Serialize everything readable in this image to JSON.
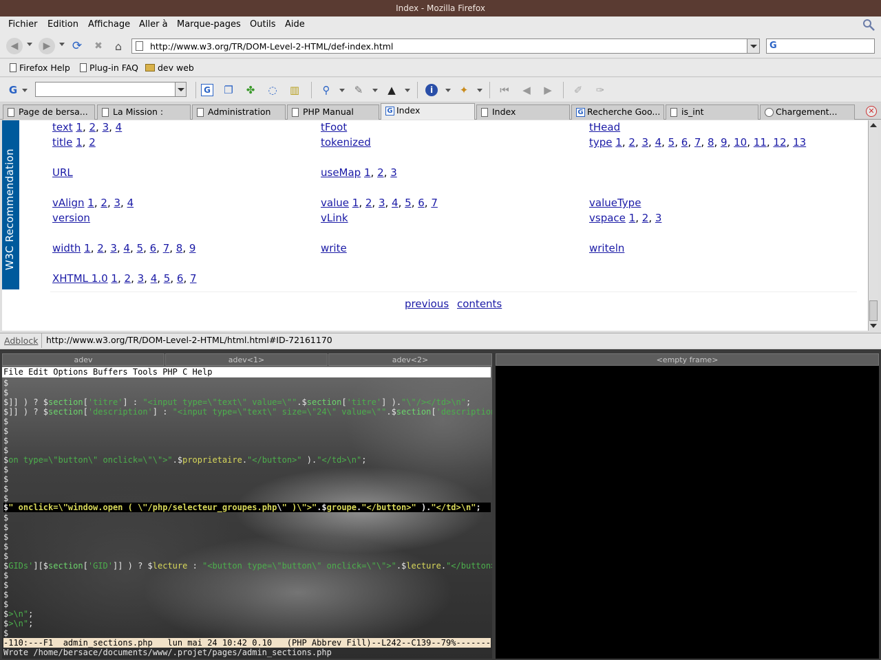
{
  "window": {
    "title": "Index - Mozilla Firefox"
  },
  "menu": [
    "Fichier",
    "Edition",
    "Affichage",
    "Aller à",
    "Marque-pages",
    "Outils",
    "Aide"
  ],
  "navigation": {
    "url": "http://www.w3.org/TR/DOM-Level-2-HTML/def-index.html",
    "search_value": ""
  },
  "bookmarks": [
    {
      "label": "Firefox Help",
      "icon": "page-icon"
    },
    {
      "label": "Plug-in FAQ",
      "icon": "page-icon"
    },
    {
      "label": "dev web",
      "icon": "folder-icon"
    }
  ],
  "tabs": [
    {
      "label": "Page de bersa...",
      "icon": "page-icon"
    },
    {
      "label": "La Mission :",
      "icon": "page-icon"
    },
    {
      "label": "Administration",
      "icon": "page-icon"
    },
    {
      "label": "PHP Manual",
      "icon": "page-icon"
    },
    {
      "label": "Index",
      "icon": "google-icon",
      "active": true
    },
    {
      "label": "Index",
      "icon": "page-icon"
    },
    {
      "label": "Recherche Goo...",
      "icon": "google-icon"
    },
    {
      "label": "is_int",
      "icon": "page-icon"
    },
    {
      "label": "Chargement...",
      "icon": "loading-icon"
    }
  ],
  "page": {
    "sidebar_label": "W3C Recommendation",
    "rows": [
      [
        {
          "term": "text",
          "refs": [
            "1",
            "2",
            "3",
            "4"
          ]
        },
        {
          "term": "tFoot",
          "refs": []
        },
        {
          "term": "tHead",
          "refs": []
        }
      ],
      [
        {
          "term": "title",
          "refs": [
            "1",
            "2"
          ]
        },
        {
          "term": "tokenized",
          "refs": []
        },
        {
          "term": "type",
          "refs": [
            "1",
            "2",
            "3",
            "4",
            "5",
            "6",
            "7",
            "8",
            "9",
            "10",
            "11",
            "12",
            "13"
          ]
        }
      ],
      [
        {
          "term": "URL",
          "refs": []
        },
        {
          "term": "useMap",
          "refs": [
            "1",
            "2",
            "3"
          ]
        },
        null
      ],
      [
        {
          "term": "vAlign",
          "refs": [
            "1",
            "2",
            "3",
            "4"
          ]
        },
        {
          "term": "value",
          "refs": [
            "1",
            "2",
            "3",
            "4",
            "5",
            "6",
            "7"
          ]
        },
        {
          "term": "valueType",
          "refs": []
        }
      ],
      [
        {
          "term": "version",
          "refs": []
        },
        {
          "term": "vLink",
          "refs": []
        },
        {
          "term": "vspace",
          "refs": [
            "1",
            "2",
            "3"
          ]
        }
      ],
      [
        {
          "term": "width",
          "refs": [
            "1",
            "2",
            "3",
            "4",
            "5",
            "6",
            "7",
            "8",
            "9"
          ]
        },
        {
          "term": "write",
          "refs": []
        },
        {
          "term": "writeln",
          "refs": []
        }
      ],
      [
        {
          "term": "XHTML 1.0",
          "refs": [
            "1",
            "2",
            "3",
            "4",
            "5",
            "6",
            "7"
          ]
        },
        null,
        null
      ]
    ],
    "footer_links": {
      "previous": "previous",
      "contents": "contents"
    }
  },
  "status": {
    "adblock": "Adblock",
    "url": "http://www.w3.org/TR/DOM-Level-2-HTML/html.html#ID-72161170"
  },
  "terminal": {
    "tabs": [
      "adev",
      "adev<1>",
      "adev<2>"
    ],
    "empty_frame_label": "<empty frame>",
    "emacs_menu": "File Edit Options Buffers Tools PHP C Help",
    "modeline": "-110:---F1  admin_sections.php   lun mai 24 10:42 0.10   (PHP Abbrev Fill)--L242--C139--79%----------",
    "echo": "Wrote /home/bersace/documents/www/.projet/pages/admin_sections.php"
  },
  "colors": {
    "titlebar": "#5a3b32",
    "w3c_blue": "#005a9c",
    "link": "#1a1aa6",
    "modeline_bg": "#f2e2c8",
    "php_green": "#6bd46b"
  }
}
